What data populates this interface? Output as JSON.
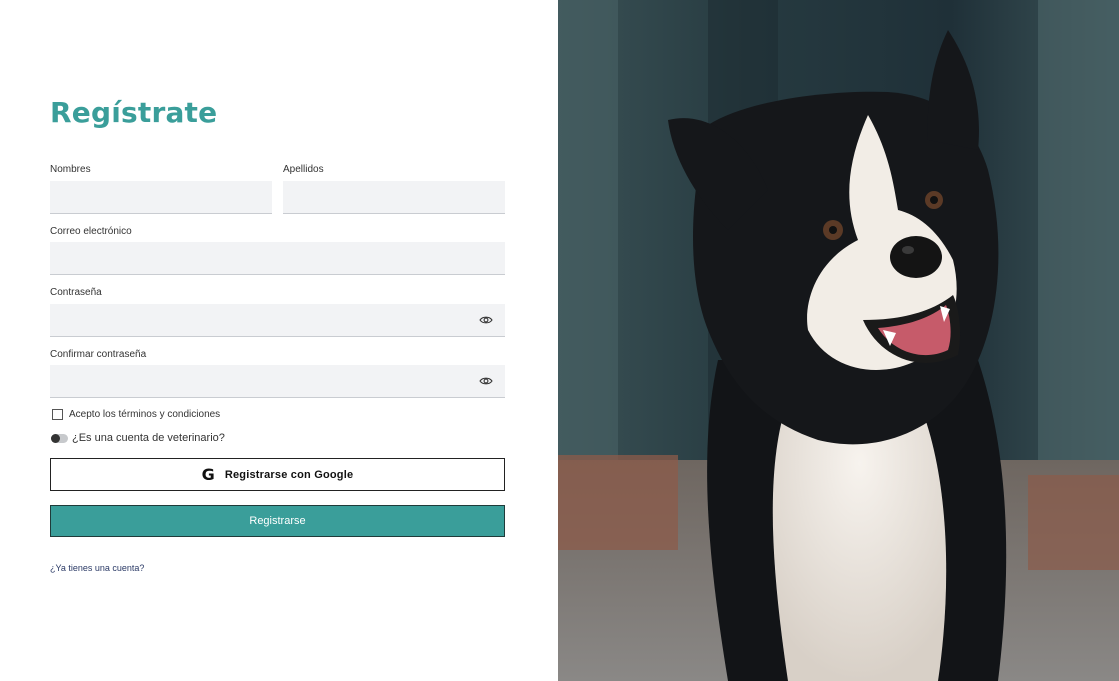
{
  "form": {
    "title": "Regístrate",
    "first_name": {
      "label": "Nombres",
      "value": "",
      "placeholder": ""
    },
    "last_name": {
      "label": "Apellidos",
      "value": "",
      "placeholder": ""
    },
    "email": {
      "label": "Correo electrónico",
      "value": "",
      "placeholder": ""
    },
    "password": {
      "label": "Contraseña",
      "value": "",
      "placeholder": ""
    },
    "confirm_password": {
      "label": "Confirmar contraseña",
      "value": "",
      "placeholder": ""
    },
    "terms_label": "Acepto los términos y condiciones",
    "terms_checked": false,
    "vet_label": "¿Es una cuenta de veterinario?",
    "vet_enabled": false,
    "google_button": "Registrarse con Google",
    "google_icon_glyph": "G",
    "submit_button": "Registrarse",
    "login_link": "¿Ya tienes una cuenta?"
  },
  "icons": {
    "password_toggle": "eye-icon",
    "google": "google-icon"
  },
  "colors": {
    "accent": "#3a9e9a",
    "field_bg": "#f2f3f5",
    "link": "#2b3a66"
  },
  "hero_image": "border-collie-dog-photo"
}
